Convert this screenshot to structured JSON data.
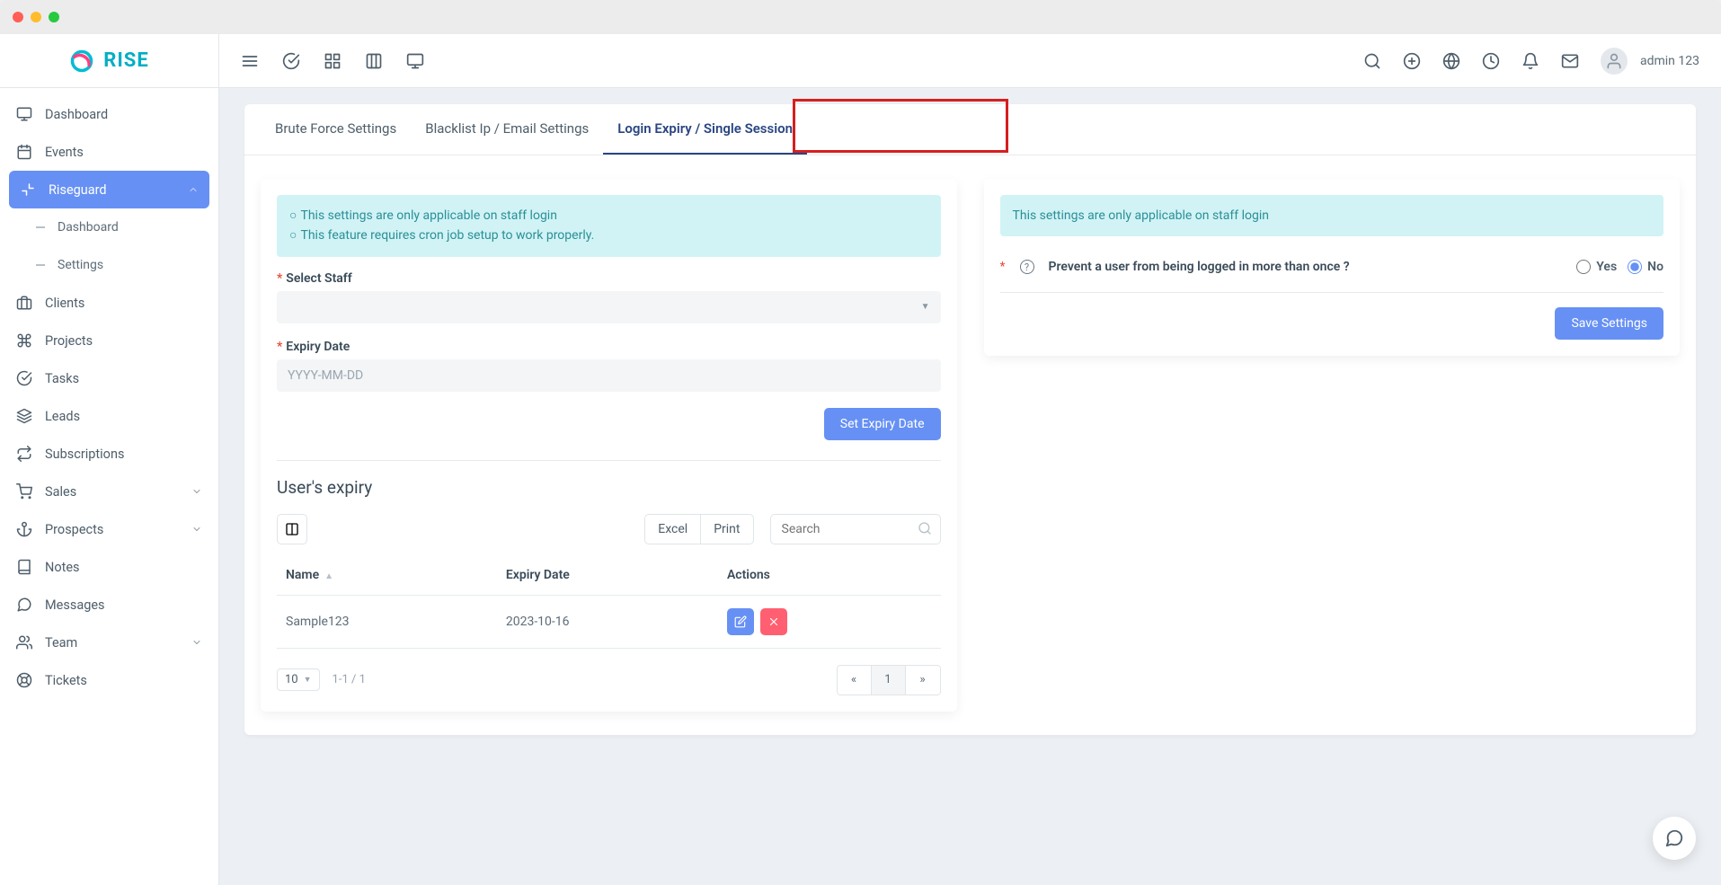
{
  "brand": "RISE",
  "user": {
    "name": "admin 123"
  },
  "sidebar": {
    "items": [
      {
        "label": "Dashboard",
        "icon": "monitor"
      },
      {
        "label": "Events",
        "icon": "calendar"
      },
      {
        "label": "Riseguard",
        "icon": "minimize",
        "active": true,
        "expanded": true,
        "children": [
          {
            "label": "Dashboard"
          },
          {
            "label": "Settings"
          }
        ]
      },
      {
        "label": "Clients",
        "icon": "briefcase"
      },
      {
        "label": "Projects",
        "icon": "command"
      },
      {
        "label": "Tasks",
        "icon": "check-circle"
      },
      {
        "label": "Leads",
        "icon": "layers"
      },
      {
        "label": "Subscriptions",
        "icon": "repeat"
      },
      {
        "label": "Sales",
        "icon": "cart",
        "expandable": true
      },
      {
        "label": "Prospects",
        "icon": "anchor",
        "expandable": true
      },
      {
        "label": "Notes",
        "icon": "book"
      },
      {
        "label": "Messages",
        "icon": "message"
      },
      {
        "label": "Team",
        "icon": "users",
        "expandable": true
      },
      {
        "label": "Tickets",
        "icon": "lifebuoy"
      }
    ]
  },
  "tabs": [
    {
      "label": "Brute Force Settings"
    },
    {
      "label": "Blacklist Ip / Email Settings"
    },
    {
      "label": "Login Expiry / Single Session",
      "active": true
    }
  ],
  "leftPanel": {
    "info": [
      "This settings are only applicable on staff login",
      "This feature requires cron job setup to work properly."
    ],
    "selectStaffLabel": "Select Staff",
    "expiryDateLabel": "Expiry Date",
    "expiryPlaceholder": "YYYY-MM-DD",
    "submitLabel": "Set Expiry Date",
    "sectionTitle": "User's expiry",
    "exportExcel": "Excel",
    "exportPrint": "Print",
    "searchPlaceholder": "Search",
    "columns": {
      "name": "Name",
      "expiry": "Expiry Date",
      "actions": "Actions"
    },
    "rows": [
      {
        "name": "Sample123",
        "expiry": "2023-10-16"
      }
    ],
    "pageSize": "10",
    "pageInfo": "1-1 / 1",
    "currentPage": "1"
  },
  "rightPanel": {
    "info": "This settings are only applicable on staff login",
    "question": "Prevent a user from being logged in more than once ?",
    "optYes": "Yes",
    "optNo": "No",
    "saveLabel": "Save Settings"
  }
}
